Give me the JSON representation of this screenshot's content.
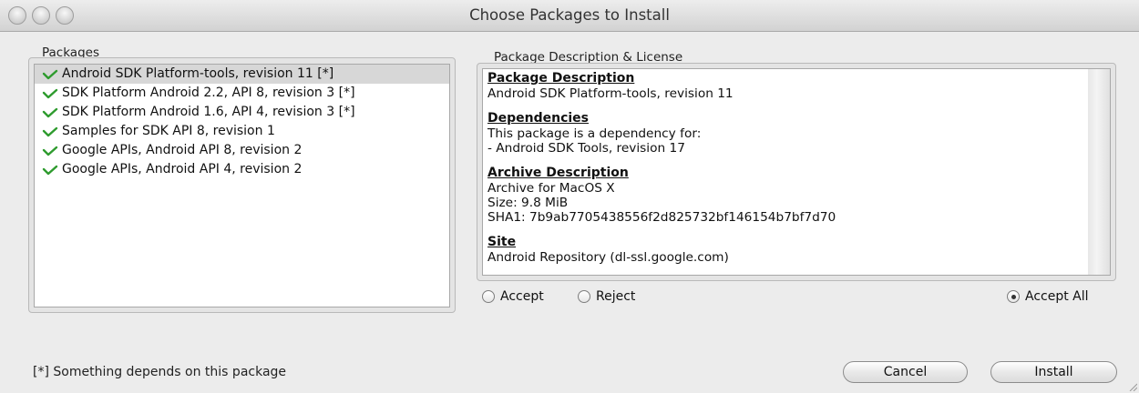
{
  "window": {
    "title": "Choose Packages to Install"
  },
  "packages": {
    "label": "Packages",
    "items": [
      {
        "label": "Android SDK Platform-tools, revision 11 [*]",
        "selected": true
      },
      {
        "label": "SDK Platform Android 2.2, API 8, revision 3 [*]",
        "selected": false
      },
      {
        "label": "SDK Platform Android 1.6, API 4, revision 3 [*]",
        "selected": false
      },
      {
        "label": "Samples for SDK API 8, revision 1",
        "selected": false
      },
      {
        "label": "Google APIs, Android API 8, revision 2",
        "selected": false
      },
      {
        "label": "Google APIs, Android API 4, revision 2",
        "selected": false
      }
    ],
    "check_icon": "green-check-icon",
    "check_color": "#2e9b2e"
  },
  "description": {
    "label": "Package Description & License",
    "package_heading": "Package Description",
    "package_text": "Android SDK Platform-tools, revision 11",
    "dependencies_heading": "Dependencies",
    "dependencies_line1": "This package is a dependency for:",
    "dependencies_line2": "- Android SDK Tools, revision 17",
    "archive_heading": "Archive Description",
    "archive_line1": "Archive for MacOS X",
    "archive_line2": "Size: 9.8 MiB",
    "archive_line3": "SHA1: 7b9ab7705438556f2d825732bf146154b7bf7d70",
    "site_heading": "Site",
    "site_text": "Android Repository (dl-ssl.google.com)"
  },
  "license": {
    "accept_label": "Accept",
    "reject_label": "Reject",
    "accept_all_label": "Accept All",
    "selected": "accept_all"
  },
  "footer": {
    "note": "[*] Something depends on this package",
    "cancel_label": "Cancel",
    "install_label": "Install"
  }
}
